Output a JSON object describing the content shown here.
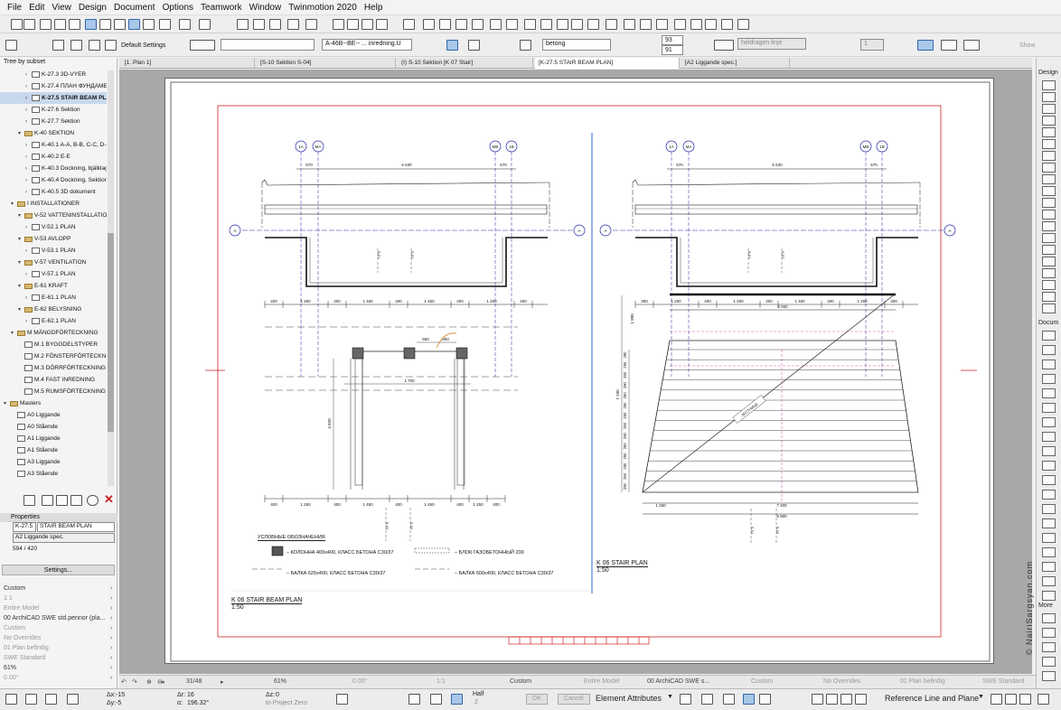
{
  "menu": [
    "File",
    "Edit",
    "View",
    "Design",
    "Document",
    "Options",
    "Teamwork",
    "Window",
    "Twinmotion 2020",
    "Help"
  ],
  "info_box": {
    "default_settings": "Default Settings",
    "layer_value": "A-46B--BE-- ... inredning.U",
    "fill_name": "betong",
    "angle_1": "93",
    "angle_2": "91",
    "line_type": "heldragen linje",
    "pen_value": "1",
    "show_label": "Show"
  },
  "navigator": {
    "title": "Tree by subset",
    "items": [
      {
        "label": "K-27.3 3D-VYER",
        "indent": 3,
        "type": "page"
      },
      {
        "label": "K-27.4 ПЛАН ФУНДАМЕНТ",
        "indent": 3,
        "type": "page"
      },
      {
        "label": "K-27.5 STAIR BEAM PLAN",
        "indent": 3,
        "type": "page",
        "selected": true
      },
      {
        "label": "K-27.6 Sektion",
        "indent": 3,
        "type": "page"
      },
      {
        "label": "K-27.7 Sektion",
        "indent": 3,
        "type": "page"
      },
      {
        "label": "K-40 SEKTION",
        "indent": 2,
        "type": "folder",
        "open": true
      },
      {
        "label": "K-40.1 A-A, B-B, C-C, D-D",
        "indent": 3,
        "type": "page"
      },
      {
        "label": "K-40.2 E-E",
        "indent": 3,
        "type": "page"
      },
      {
        "label": "K-40.3 Dockning, bjälklag",
        "indent": 3,
        "type": "page"
      },
      {
        "label": "K-40.4 Dockning, Sektion",
        "indent": 3,
        "type": "page"
      },
      {
        "label": "K-40.5 3D dokument",
        "indent": 3,
        "type": "page"
      },
      {
        "label": "I INSTALLATIONER",
        "indent": 1,
        "type": "folder",
        "open": true
      },
      {
        "label": "V-52 VATTENINSTALLATION",
        "indent": 2,
        "type": "folder",
        "open": true
      },
      {
        "label": "V-52.1 PLAN",
        "indent": 3,
        "type": "page"
      },
      {
        "label": "V-53 AVLOPP",
        "indent": 2,
        "type": "folder",
        "open": true
      },
      {
        "label": "V-53.1 PLAN",
        "indent": 3,
        "type": "page"
      },
      {
        "label": "V-57 VENTILATION",
        "indent": 2,
        "type": "folder",
        "open": true
      },
      {
        "label": "V-57.1 PLAN",
        "indent": 3,
        "type": "page"
      },
      {
        "label": "E-61 KRAFT",
        "indent": 2,
        "type": "folder",
        "open": true
      },
      {
        "label": "E-61.1 PLAN",
        "indent": 3,
        "type": "page"
      },
      {
        "label": "E-62 BELYSNING",
        "indent": 2,
        "type": "folder",
        "open": true
      },
      {
        "label": "E-62.1 PLAN",
        "indent": 3,
        "type": "page"
      },
      {
        "label": "M MÄNGDFÖRTECKNING",
        "indent": 1,
        "type": "folder",
        "open": true
      },
      {
        "label": "M.1 BYGGDELSTYPER",
        "indent": 2,
        "type": "page"
      },
      {
        "label": "M.2 FÖNSTERFÖRTECKNING",
        "indent": 2,
        "type": "page"
      },
      {
        "label": "M.3 DÖRRFÖRTECKNING",
        "indent": 2,
        "type": "page"
      },
      {
        "label": "M.4 FAST INREDNING",
        "indent": 2,
        "type": "page"
      },
      {
        "label": "M.5 RUMSFÖRTECKNING",
        "indent": 2,
        "type": "page"
      },
      {
        "label": "Masters",
        "indent": 0,
        "type": "folder",
        "open": true
      },
      {
        "label": "A0 Liggande",
        "indent": 1,
        "type": "page"
      },
      {
        "label": "A0 Stående",
        "indent": 1,
        "type": "page"
      },
      {
        "label": "A1 Liggande",
        "indent": 1,
        "type": "page"
      },
      {
        "label": "A1 Stående",
        "indent": 1,
        "type": "page"
      },
      {
        "label": "A3 Liggande",
        "indent": 1,
        "type": "page"
      },
      {
        "label": "A3 Stående",
        "indent": 1,
        "type": "page"
      }
    ]
  },
  "properties": {
    "title": "Properties",
    "id": "K-27.5",
    "name": "STAIR BEAM PLAN",
    "master": "A2 Liggande spec.",
    "size": "594 / 420",
    "settings_button": "Settings...",
    "rows": [
      {
        "label": "Custom",
        "dim": false
      },
      {
        "label": "1:1",
        "dim": true
      },
      {
        "label": "Entire Model",
        "dim": true
      },
      {
        "label": "00 ArchiCAD SWE std.pennor (pla...",
        "dim": false
      },
      {
        "label": "Custom",
        "dim": true
      },
      {
        "label": "No Overrides",
        "dim": true
      },
      {
        "label": "01 Plan befintlig",
        "dim": true
      },
      {
        "label": "SWE Standard",
        "dim": true
      },
      {
        "label": "61%",
        "dim": false
      },
      {
        "label": "0.00°",
        "dim": true
      }
    ]
  },
  "tabs": [
    {
      "label": "[1. Plan 1]",
      "active": false
    },
    {
      "label": "[S-10 Sektion S-04]",
      "active": false
    },
    {
      "label": "(I) S-10 Sektion  [K 07 Stair]",
      "active": false
    },
    {
      "label": "[K-27.5 STAIR BEAM PLAN]",
      "active": true
    },
    {
      "label": "[A2 Liggande spec.]",
      "active": false
    }
  ],
  "right_toolbar": {
    "design": "Design",
    "document": "Docum",
    "more": "More"
  },
  "drawing": {
    "left_title": "K 06 STAIR BEAM PLAN",
    "left_scale": "1:50",
    "right_title": "K 06 STAIR PLAN",
    "right_scale": "1:50",
    "grid_labels": [
      "1A",
      "MA",
      "MB",
      "1B"
    ],
    "axis_label": "A",
    "dim_top": [
      "570",
      "6 530",
      "570"
    ],
    "dims_row_left": [
      "400",
      "1 250",
      "400",
      "1 450",
      "400",
      "1 450",
      "400",
      "1 250",
      "400"
    ],
    "dims_row_right": [
      "300",
      "1 250",
      "400",
      "1 450",
      "400",
      "1 450",
      "400",
      "1 250",
      "300"
    ],
    "dim_overall": "8 000",
    "dim_beam": "550",
    "dim_beam2": "900",
    "dim_1700": "1 700",
    "dim_4820": "4 820",
    "dim_1880": "1 880",
    "dim_7100": "7 100",
    "dim_stairs": "7 400",
    "dim_stairs2": "9 900",
    "dim_1250": "1 250",
    "stair_steps": [
      "290",
      "290",
      "290",
      "290",
      "290",
      "290",
      "290",
      "290",
      "290",
      "290",
      "290",
      "290",
      "290",
      "290"
    ],
    "section_marks": [
      "S-01",
      "S-02"
    ],
    "legend_title": "УСЛОВНЫЕ ОБОЗНАЧЕНИЯ",
    "legend": [
      "– КОЛОННА 400x400, КЛАСС БЕТОНА C30/37",
      "– БЛОК ГАЗОБЕТОННЫЙ 200",
      "– БАЛКА 625x400, КЛАСС БЕТОНА C30/37",
      "– БАЛКА 500x400, КЛАСС БЕТОНА C30/37"
    ],
    "stair_label": "ЛЕСТНИЦА"
  },
  "statusbar": {
    "page": "31/48",
    "zoom": "61%",
    "angle": "0.00°",
    "scale": "1:1",
    "custom": "Custom",
    "model": "Entire Model",
    "pens": "00 ArchiCAD SWE s...",
    "custom2": "Custom",
    "overrides": "No Overrides",
    "renovation": "01 Plan befintlig",
    "standard": "SWE Standard"
  },
  "bottombar": {
    "dx_label": "Δx:",
    "dx": "-15",
    "dy_label": "Δy:",
    "dy": "-5",
    "r_label": "Δr:",
    "r": "16",
    "a_label": "α:",
    "a": "196.32°",
    "z_label": "Δz:",
    "z": "0",
    "to_project_zero": "to Project Zero",
    "half": "Half",
    "half_val": "2",
    "ok": "OK",
    "cancel": "Cancel",
    "element_attributes": "Element Attributes",
    "reference_line": "Reference Line and Plane"
  },
  "watermark": "© NairiSargsyan.com",
  "colors": {
    "accent": "#3366aa",
    "selection": "#c8d8ec",
    "border_red": "#cc2222",
    "grid_blue": "#2222aa",
    "dim_magenta": "#cc3399"
  }
}
